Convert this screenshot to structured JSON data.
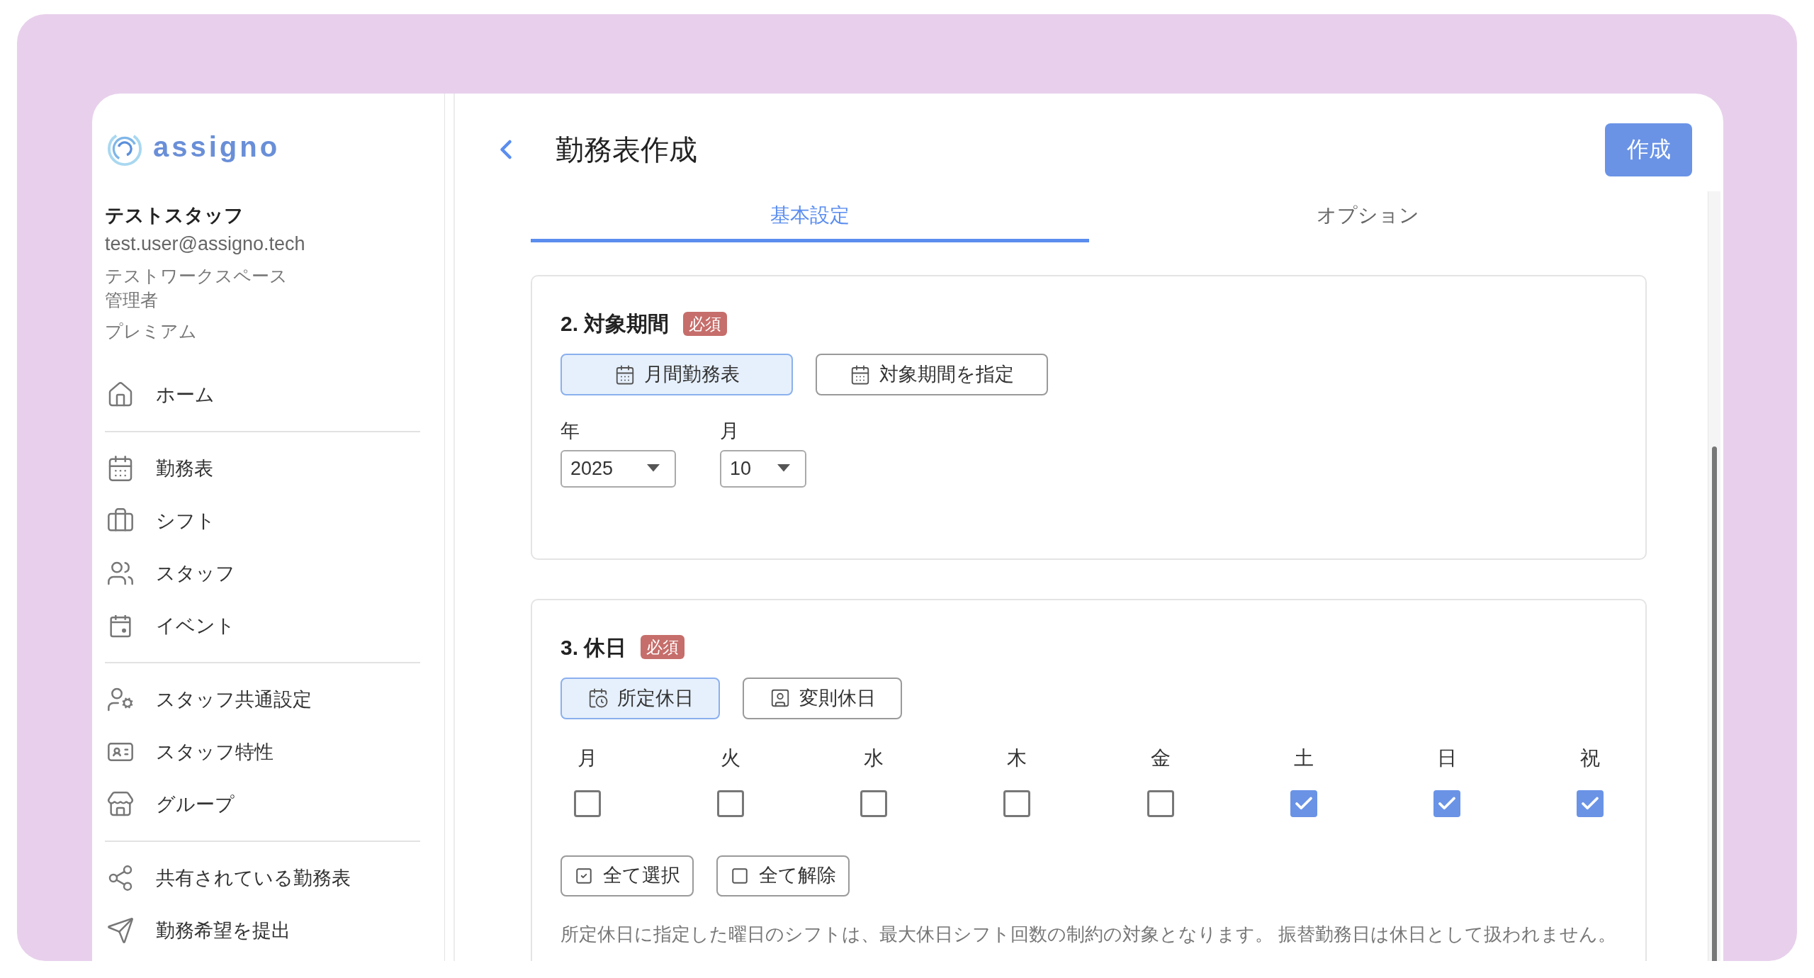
{
  "brand": {
    "name": "assigno"
  },
  "user": {
    "name": "テストスタッフ",
    "email": "test.user@assigno.tech",
    "workspace": "テストワークスペース",
    "role": "管理者",
    "plan": "プレミアム"
  },
  "nav_groups": [
    [
      {
        "label": "ホーム",
        "kind": "home"
      }
    ],
    [
      {
        "label": "勤務表",
        "kind": "calendar"
      },
      {
        "label": "シフト",
        "kind": "briefcase"
      },
      {
        "label": "スタッフ",
        "kind": "users"
      },
      {
        "label": "イベント",
        "kind": "event"
      }
    ],
    [
      {
        "label": "スタッフ共通設定",
        "kind": "user-gear"
      },
      {
        "label": "スタッフ特性",
        "kind": "badge"
      },
      {
        "label": "グループ",
        "kind": "store"
      }
    ],
    [
      {
        "label": "共有されている勤務表",
        "kind": "share"
      },
      {
        "label": "勤務希望を提出",
        "kind": "send"
      }
    ]
  ],
  "header": {
    "title": "勤務表作成",
    "create_button": "作成"
  },
  "tabs": [
    {
      "label": "基本設定",
      "selected": true
    },
    {
      "label": "オプション",
      "selected": false
    }
  ],
  "sections": [
    {
      "title": "2. 対象期間",
      "badge": "必須",
      "modes": [
        {
          "label": "月間勤務表",
          "kind": "calendar",
          "selected": true
        },
        {
          "label": "対象期間を指定",
          "kind": "calendar",
          "selected": false
        }
      ],
      "selects": [
        {
          "label": "年",
          "value": "2025"
        },
        {
          "label": "月",
          "value": "10"
        }
      ]
    },
    {
      "title": "3. 休日",
      "badge": "必須",
      "modes": [
        {
          "label": "所定休日",
          "kind": "calendar-clock",
          "selected": true
        },
        {
          "label": "変則休日",
          "kind": "portrait",
          "selected": false
        }
      ],
      "days": [
        {
          "label": "月",
          "checked": false
        },
        {
          "label": "火",
          "checked": false
        },
        {
          "label": "水",
          "checked": false
        },
        {
          "label": "木",
          "checked": false
        },
        {
          "label": "金",
          "checked": false
        },
        {
          "label": "土",
          "checked": true
        },
        {
          "label": "日",
          "checked": true
        },
        {
          "label": "祝",
          "checked": true
        }
      ],
      "actions": [
        {
          "label": "全て選択",
          "kind": "check-all"
        },
        {
          "label": "全て解除",
          "kind": "clear-all"
        }
      ],
      "note": "所定休日に指定した曜日のシフトは、最大休日シフト回数の制約の対象となります。 振替勤務日は休日として扱われません。"
    }
  ]
}
